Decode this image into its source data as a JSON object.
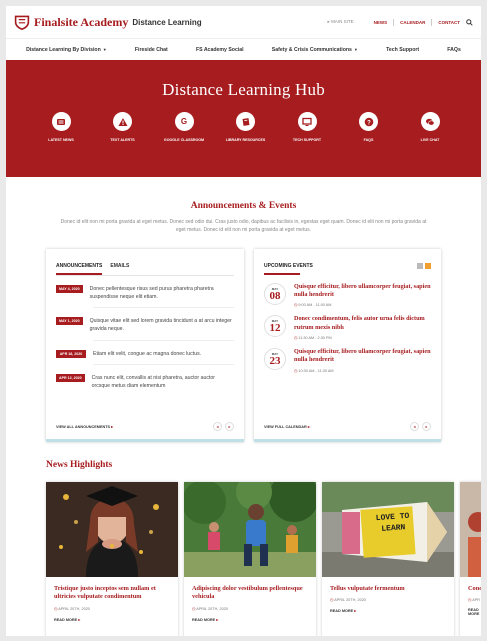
{
  "header": {
    "brand": "Finalsite Academy",
    "brand_sub": "Distance Learning",
    "main_site": "MAIN SITE",
    "links": [
      "NEWS",
      "CALENDAR",
      "CONTACT"
    ]
  },
  "nav": {
    "items": [
      "Distance Learning By Division",
      "Fireside Chat",
      "FS Academy Social",
      "Safety & Crisis Communications",
      "Tech Support",
      "FAQs"
    ]
  },
  "hero": {
    "title": "Distance Learning Hub",
    "quicklinks": [
      {
        "label": "LATEST NEWS",
        "icon": "news-icon"
      },
      {
        "label": "TEXT ALERTS",
        "icon": "alert-icon"
      },
      {
        "label": "GOOGLE CLASSROOM",
        "icon": "google-icon"
      },
      {
        "label": "LIBRARY RESOURCES",
        "icon": "book-icon"
      },
      {
        "label": "TECH SUPPORT",
        "icon": "monitor-icon"
      },
      {
        "label": "FAQS",
        "icon": "question-icon"
      },
      {
        "label": "LIVE CHAT",
        "icon": "chat-icon"
      }
    ]
  },
  "announcements": {
    "title": "Announcements & Events",
    "intro": "Donec id elit non mi porta gravida at eget metus. Donec sed odio dui. Cras justo odio, dapibus ac facilisis in, egestas eget quam. Donec id elit non mi porta gravida at eget metus. Donec id elit non mi porta gravida at eget metus.",
    "tabs": [
      "ANNOUNCEMENTS",
      "EMAILS"
    ],
    "items": [
      {
        "date": "MAY 4, 2020",
        "text": "Donec pellentesque risus sed purus pharetra pharetra suspendisse neque elit etiam."
      },
      {
        "date": "MAY 1, 2020",
        "text": "Quisque vitae elit sed lorem gravida tincidunt a at arcu integer gravida neque."
      },
      {
        "date": "APR 18, 2020",
        "text": "Etiam elit velit, congue ac magna donec luctus."
      },
      {
        "date": "APR 12, 2020",
        "text": "Cras nunc elit, convallis at nisi pharetra, auctor auctor orcsque metus diam elementum"
      }
    ],
    "view_all": "VIEW ALL ANNOUNCEMENTS"
  },
  "events": {
    "title": "UPCOMING EVENTS",
    "items": [
      {
        "month": "MAY",
        "day": "08",
        "title": "Quisque efficitur, libero ullamcorper feugiat, sapien nulla hendrerit",
        "time": "9:00 AM - 11:00 AM"
      },
      {
        "month": "MAY",
        "day": "12",
        "title": "Donec condimentum, felis autor urna felis dictum rutrum mexis nibh",
        "time": "11:30 AM - 2:30 PM"
      },
      {
        "month": "MAY",
        "day": "23",
        "title": "Quisque efficitur, libero ullamcorper feugiat, sapien nulla hendrerit",
        "time": "10:30 AM - 11:30 AM"
      }
    ],
    "view_all": "VIEW FULL CALENDAR"
  },
  "news": {
    "title": "News Highlights",
    "cards": [
      {
        "title": "Tristique justo inceptos sem nullam et ultricies vulputate condimentum",
        "date": "APRIL 20TH, 2020",
        "more": "READ MORE"
      },
      {
        "title": "Adipiscing dolor vestibulum pellentesque vehicula",
        "date": "APRIL 20TH, 2020",
        "more": "READ MORE"
      },
      {
        "title": "Tellus vulputate fermentum",
        "date": "APRIL 20TH, 2020",
        "more": "READ MORE"
      },
      {
        "title": "Cond",
        "date": "APR",
        "more": "READ MORE"
      }
    ],
    "sign_text": "LOVE TO LEARN"
  },
  "colors": {
    "brand_red": "#a61c1f",
    "accent_teal": "#bfe0e6"
  }
}
